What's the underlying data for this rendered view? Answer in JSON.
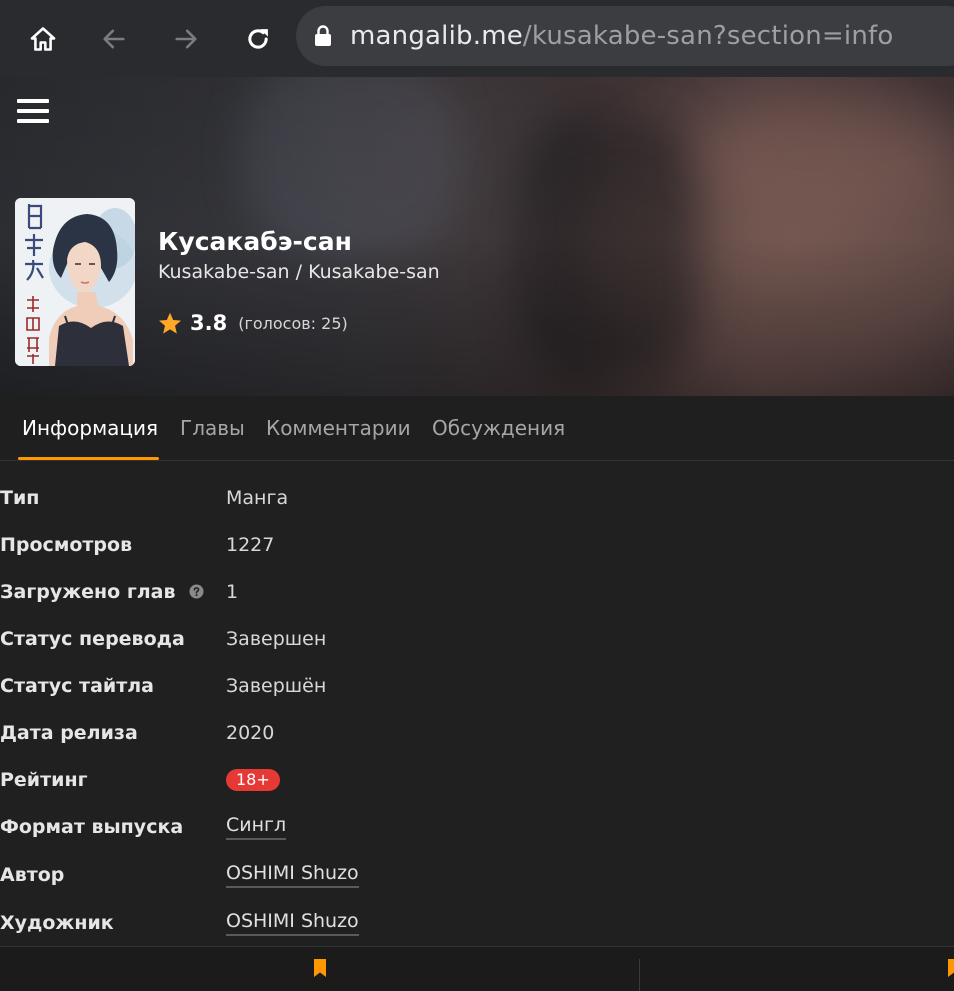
{
  "browser": {
    "url_domain": "mangalib.me",
    "url_path": "/kusakabe-san?section=info"
  },
  "manga": {
    "title": "Кусакабэ-сан",
    "subtitle": "Kusakabe-san / Kusakabe-san",
    "rating": "3.8",
    "votes": "(голосов: 25)"
  },
  "tabs": [
    {
      "label": "Информация"
    },
    {
      "label": "Главы"
    },
    {
      "label": "Комментарии"
    },
    {
      "label": "Обсуждения"
    }
  ],
  "info": [
    {
      "label": "Тип",
      "value": "Манга"
    },
    {
      "label": "Просмотров",
      "value": "1227"
    },
    {
      "label": "Загружено глав",
      "value": "1"
    },
    {
      "label": "Статус перевода",
      "value": "Завершен"
    },
    {
      "label": "Статус тайтла",
      "value": "Завершён"
    },
    {
      "label": "Дата релиза",
      "value": "2020"
    },
    {
      "label": "Рейтинг",
      "value": "18+"
    },
    {
      "label": "Формат выпуска",
      "value": "Сингл"
    },
    {
      "label": "Автор",
      "value": "OSHIMI Shuzo"
    },
    {
      "label": "Художник",
      "value": "OSHIMI Shuzo"
    }
  ],
  "colors": {
    "accent": "#ff9800",
    "badge": "#e53935",
    "background": "#202020"
  },
  "icons": {
    "home": "home-icon",
    "back": "arrow-left-icon",
    "forward": "arrow-right-icon",
    "reload": "reload-icon",
    "lock": "lock-icon",
    "menu": "hamburger-menu-icon",
    "star": "star-icon",
    "help": "question-circle-icon",
    "bookmark": "bookmark-icon"
  }
}
